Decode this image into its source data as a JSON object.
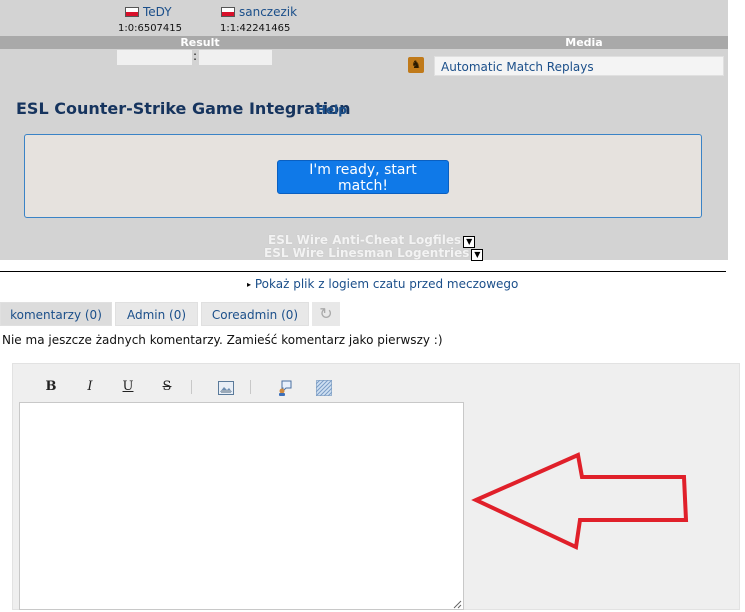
{
  "players": [
    {
      "name": "TeDY",
      "id": "1:0:6507415"
    },
    {
      "name": "sanczezik",
      "id": "1:1:42241465"
    }
  ],
  "headers": {
    "result": "Result",
    "media": "Media"
  },
  "result": {
    "separator": ":"
  },
  "media": {
    "link": "Automatic Match Replays",
    "icon": "cs-game-icon"
  },
  "integration": {
    "title": "ESL Counter-Strike Game Integration",
    "help": "Help",
    "ready_button": "I'm ready, start match!"
  },
  "logs": {
    "anticheat": "ESL Wire Anti-Cheat Logfiles",
    "linesman": "ESL Wire Linesman Logentries"
  },
  "chat_log_link": "Pokaż plik z logiem czatu przed meczowego",
  "tabs": [
    {
      "label": "komentarzy (0)"
    },
    {
      "label": "Admin (0)"
    },
    {
      "label": "Coreadmin (0)"
    }
  ],
  "no_comments": "Nie ma jeszcze żadnych komentarzy. Zamieść komentarz jako pierwszy :)",
  "toolbar": {
    "bold": "B",
    "italic": "I",
    "underline": "U",
    "strike": "S"
  },
  "colors": {
    "accent": "#0f79e8",
    "link": "#1b4f8a",
    "arrow": "#e0202a"
  }
}
